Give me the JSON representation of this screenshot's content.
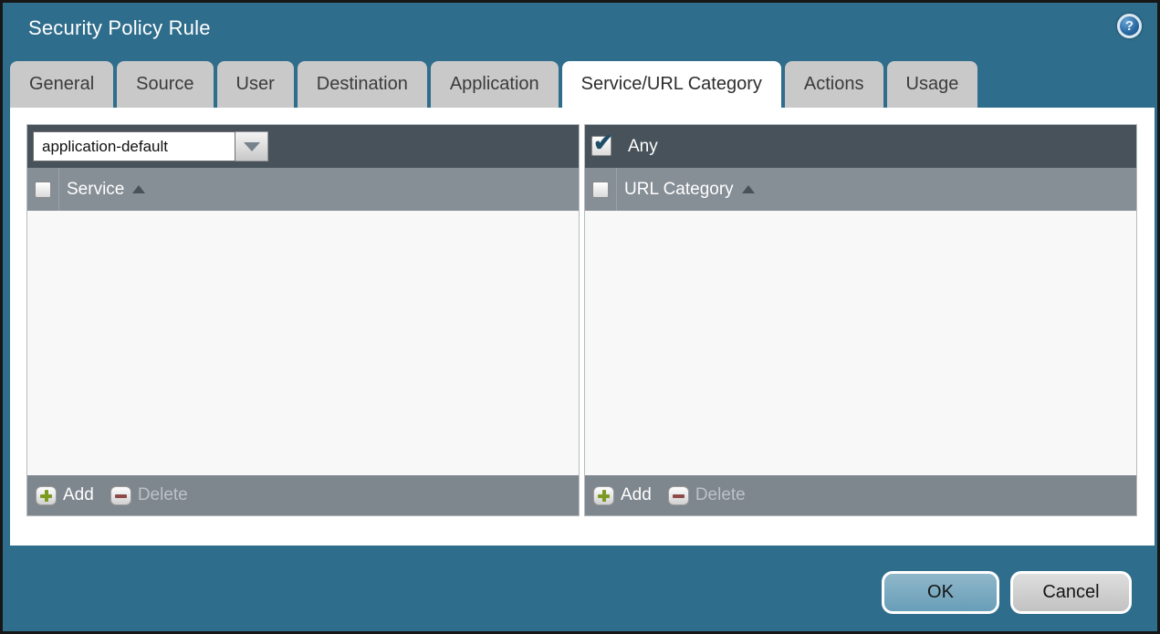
{
  "window": {
    "title": "Security Policy Rule",
    "help_glyph": "?"
  },
  "tabs": [
    {
      "label": "General"
    },
    {
      "label": "Source"
    },
    {
      "label": "User"
    },
    {
      "label": "Destination"
    },
    {
      "label": "Application"
    },
    {
      "label": "Service/URL Category",
      "active": true
    },
    {
      "label": "Actions"
    },
    {
      "label": "Usage"
    }
  ],
  "service_panel": {
    "dropdown_value": "application-default",
    "column_header": "Service",
    "add_label": "Add",
    "delete_label": "Delete",
    "rows": []
  },
  "url_panel": {
    "any_label": "Any",
    "any_checked": true,
    "check_glyph": "✔",
    "column_header": "URL Category",
    "add_label": "Add",
    "delete_label": "Delete",
    "rows": []
  },
  "footer_buttons": {
    "ok": "OK",
    "cancel": "Cancel"
  },
  "colors": {
    "dialog_bg": "#2f6d8c",
    "panel_header_bg": "#47525b",
    "column_header_bg": "#868e96",
    "panel_footer_bg": "#7e868e",
    "inactive_tab_bg": "#c9c9c9",
    "active_tab_bg": "#ffffff",
    "ok_button_bg": "#74a7bf",
    "cancel_button_bg": "#cfcfcf",
    "add_plus": "#7d9a21",
    "delete_minus": "#8d4a48"
  }
}
